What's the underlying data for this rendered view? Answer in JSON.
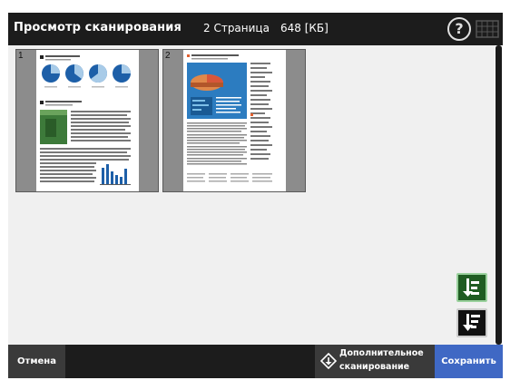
{
  "header": {
    "title": "Просмотр сканирования",
    "page_count": "2 Страница",
    "file_size": "648 [КБ]",
    "help_icon": "question-icon",
    "keyboard_icon": "keyboard-icon"
  },
  "thumbnails": [
    {
      "number": "1"
    },
    {
      "number": "2"
    }
  ],
  "side_buttons": {
    "rotate_icon": "rotate-page-icon",
    "sort_icon": "sort-pages-icon"
  },
  "footer": {
    "cancel_label": "Отмена",
    "extra_scan_line1": "Дополнительное",
    "extra_scan_line2": "сканирование",
    "extra_scan_icon": "add-scan-icon",
    "save_label": "Сохранить"
  },
  "colors": {
    "header_bg": "#1c1c1c",
    "save_accent": "#3f68c4",
    "rotate_green": "#1f5c22"
  }
}
